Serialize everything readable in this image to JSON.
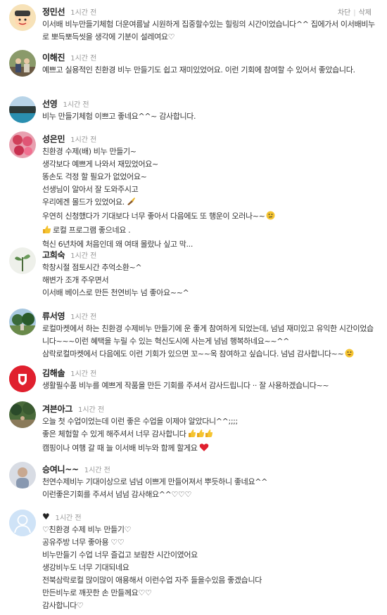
{
  "comments": [
    {
      "author": "정민선",
      "time": "1시간 전",
      "actions": {
        "block": "차단",
        "delete": "삭제"
      },
      "lines": [
        "이서배 비누만들기체험 더운여름날 시원하게 집중할수있는 힐링의 시간이었습니다^^ 집에가서 이서배비누로 뽀득뽀득씻을 생각에 기분이 설레여요♡"
      ]
    },
    {
      "author": "이해진",
      "time": "1시간 전",
      "lines": [
        "예쁘고 실용적인 친환경 비누 만들기도 쉽고 재미있었어요. 이런 기회에 참여할 수 있어서 좋았습니다."
      ]
    },
    {
      "author": "선영",
      "time": "1시간 전",
      "lines": [
        "비누 만들기체험 이쁘고 좋네요^^~ 감사합니다."
      ]
    },
    {
      "author": "성은민",
      "time": "1시간 전",
      "lines": [
        "친환경 수제(배) 비누 만들기~",
        "생각보다 예쁘게 나와서 재밌었어요~",
        "똥손도 걱정 할 필요가 없었어요~",
        "선생님이 알아서 잘 도와주시고",
        "우리에겐 몰드가 있었어요.",
        "우연히 신청했다가 기대보다 너무 좋아서 다음에도 또 행운이 오러나~~",
        "로컬 프로그램 좋으네요 .",
        "혁신 6년차에 처음인데 왜 여태 몰랐나 싶고 막..."
      ]
    },
    {
      "author": "고희숙",
      "time": "1시간 전",
      "lines": [
        "학창시절 점토시간 추억소환~^",
        "해변가 조개 주우면서",
        "이서배 베이스로 만든 천연비누 넘 좋아요~~^"
      ]
    },
    {
      "author": "류서영",
      "time": "1시간 전",
      "lines": [
        "로컬마켓에서 하는 친환경 수제비누 만들기에 운 좋게 참여하게 되었는데, 넘넘 재미있고 유익한 시간이었습니다~~~이런 혜택을 누릴 수 있는 혁신도시에 사는게 넘넘 행복하네요~~^^",
        "삼락로컬마켓에서 다음에도 이런 기회가 있으면 꼬~~옥 참여하고 싶습니다. 넘넘 감사합니다~~"
      ]
    },
    {
      "author": "김해솔",
      "time": "1시간 전",
      "lines": [
        "생활필수품 비누를 예쁘게 작품을 만든 기회를 주셔서 감사드립니다 ·· 잘 사용하겠습니다~~"
      ]
    },
    {
      "author": "겨븐아그",
      "time": "1시간 전",
      "lines": [
        "오늘 첫 수업이었는데 이런 좋은 수업을 이제야 알았다니^^;;;;",
        "좋은 체험할 수 있게 해주셔서 너무 감사합니다",
        "캠핑이나 여행 갈 때 늘 이서배 비누와 함께 할게요"
      ]
    },
    {
      "author": "승여니~~",
      "time": "1시간 전",
      "lines": [
        "천연수제비누 기대이상으로 넘넘 이쁘게 만들어져서 뿌듯하니 좋네요^^",
        "이런좋은기회를 주셔서 넘넘 감사해요^^♡♡♡"
      ]
    },
    {
      "author": "♥",
      "time": "1시간 전",
      "lines": [
        "♡친환경 수제 비누 만들기♡",
        "공유주방 너무 좋아용 ♡♡",
        "비누만들기 수업 너무 즐겁고 보람찬 시간이였어요",
        "생강비누도 너무 기대되네요",
        "전북삼락로컬 많이많이 애용해서 이런수업 자주 들을수있음 좋겠습니다",
        "만든비누로 깨끗한 손 만들께요♡♡",
        "감사합니다♡"
      ]
    }
  ]
}
